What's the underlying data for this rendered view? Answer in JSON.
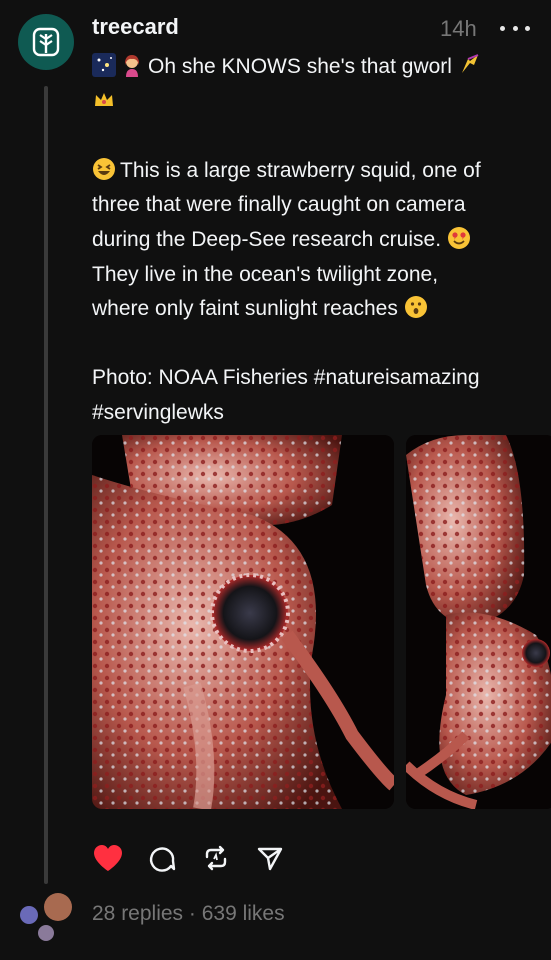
{
  "post": {
    "username": "treecard",
    "time": "14h",
    "text": {
      "line1": "Oh she KNOWS she's that gworl",
      "para2_l1": "This is a large strawberry squid, one of",
      "para2_l2": "three that were finally caught on camera",
      "para2_l3": "during the Deep-See research cruise.",
      "para2_l4": "They live in the ocean's twilight zone,",
      "para2_l5": "where only faint sunlight reaches",
      "para3_l1": "Photo: NOAA Fisheries #natureisamazing",
      "para3_l2": "#servinglewks"
    },
    "liked": true,
    "stats": "28 replies · 639 likes"
  },
  "colors": {
    "background": "#101010",
    "avatar": "#0f5a52",
    "like": "#ff3040",
    "muted": "#777777"
  },
  "icons": [
    "treecard-logo-icon",
    "more-icon",
    "heart-icon",
    "comment-icon",
    "repost-icon",
    "share-icon"
  ]
}
